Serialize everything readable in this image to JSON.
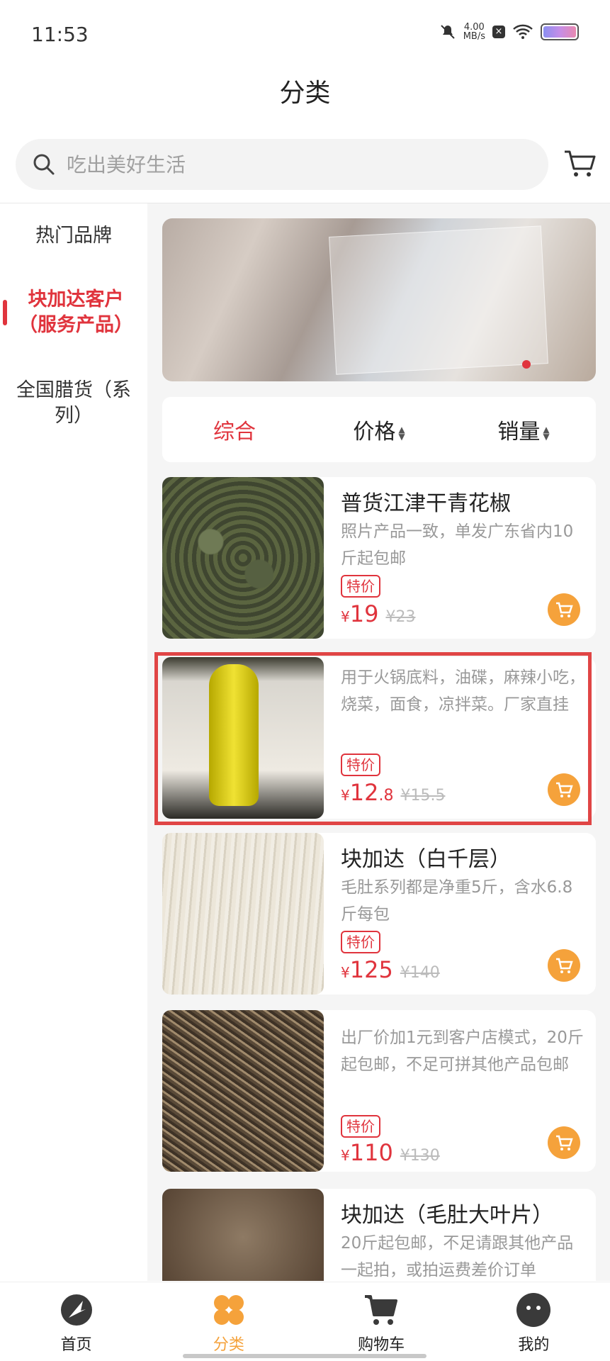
{
  "status_bar": {
    "time": "11:53",
    "net_speed_value": "4.00",
    "net_speed_unit": "MB/s"
  },
  "header": {
    "title": "分类"
  },
  "search": {
    "placeholder": "吃出美好生活"
  },
  "sidebar": {
    "items": [
      {
        "label": "热门品牌",
        "active": false
      },
      {
        "label": "块加达客户（服务产品）",
        "active": true
      },
      {
        "label": "全国腊货（系列）",
        "active": false
      }
    ]
  },
  "sort": {
    "items": [
      "综合",
      "价格",
      "销量"
    ],
    "active": "综合"
  },
  "products": [
    {
      "title": "普货江津干青花椒",
      "desc": "照片产品一致，单发广东省内10斤起包邮",
      "badge": "特价",
      "price_int": "19",
      "price_dec": "",
      "orig": "¥23"
    },
    {
      "title": "",
      "desc": "用于火锅底料，油碟，麻辣小吃，烧菜，面食，凉拌菜。厂家直挂",
      "badge": "特价",
      "price_int": "12",
      "price_dec": ".8",
      "orig": "¥15.5"
    },
    {
      "title": "块加达（白千层）",
      "desc": "毛肚系列都是净重5斤，含水6.8斤每包",
      "badge": "特价",
      "price_int": "125",
      "price_dec": "",
      "orig": "¥140"
    },
    {
      "title": "",
      "desc": "出厂价加1元到客户店模式，20斤起包邮，不足可拼其他产品包邮",
      "badge": "特价",
      "price_int": "110",
      "price_dec": "",
      "orig": "¥130"
    },
    {
      "title": "块加达（毛肚大叶片）",
      "desc": "20斤起包邮，不足请跟其他产品一起拍，或拍运费差价订单",
      "badge": "",
      "price_int": "",
      "price_dec": "",
      "orig": ""
    }
  ],
  "currency": "¥",
  "bottom_nav": [
    {
      "label": "首页",
      "icon": "home-logo-icon",
      "active": false
    },
    {
      "label": "分类",
      "icon": "category-icon",
      "active": true
    },
    {
      "label": "购物车",
      "icon": "cart-icon",
      "active": false
    },
    {
      "label": "我的",
      "icon": "profile-icon",
      "active": false
    }
  ],
  "colors": {
    "accent_red": "#e0343d",
    "accent_orange": "#f5a23b",
    "highlight_border": "#e04545"
  }
}
